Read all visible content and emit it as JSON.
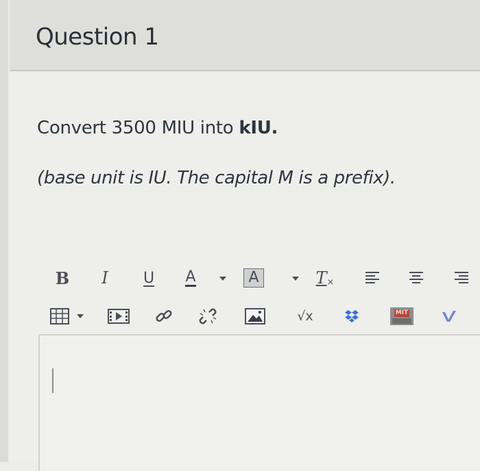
{
  "question": {
    "title": "Question 1",
    "prompt_main": "Convert 3500 MIU into ",
    "prompt_bold": "kIU.",
    "note": "(base unit is IU.  The capital M is a prefix)."
  },
  "toolbar": {
    "bold_label": "B",
    "italic_label": "I",
    "underline_label": "U",
    "font_color_label": "A",
    "highlight_label": "A",
    "remove_format_label": "T",
    "math_label": "√x",
    "mit_label": "MIT"
  },
  "colors": {
    "header_bg": "#dededa",
    "content_bg": "#eeeeea",
    "dropbox_blue": "#3a6fd8",
    "vimeo_blue": "#6c86d6",
    "mit_red": "#b8443a"
  }
}
